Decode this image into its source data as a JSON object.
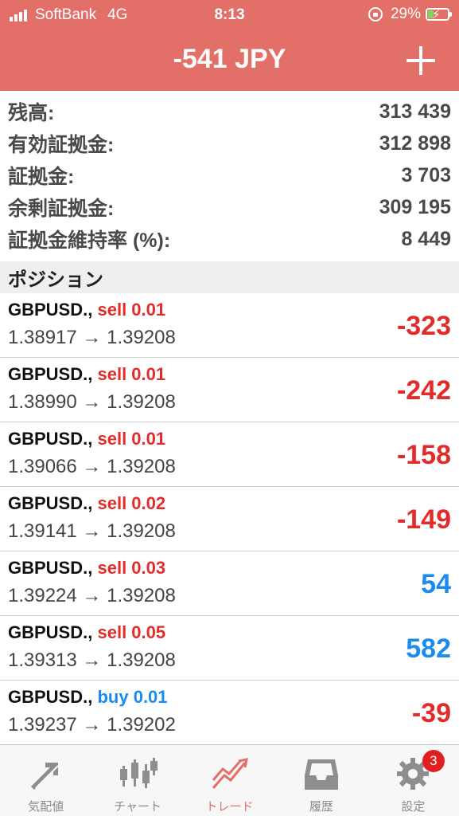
{
  "status_bar": {
    "carrier": "SoftBank",
    "network": "4G",
    "time": "8:13",
    "battery_percent": "29%",
    "battery_level": 0.29
  },
  "header": {
    "title": "-541 JPY",
    "add_icon": "plus-icon"
  },
  "summary": [
    {
      "label": "残高:",
      "value": "313 439"
    },
    {
      "label": "有効証拠金:",
      "value": "312 898"
    },
    {
      "label": "証拠金:",
      "value": "3 703"
    },
    {
      "label": "余剰証拠金:",
      "value": "309 195"
    },
    {
      "label": "証拠金維持率 (%):",
      "value": "8 449"
    }
  ],
  "positions_header": "ポジション",
  "positions": [
    {
      "symbol": "GBPUSD.,",
      "side": "sell 0.01",
      "prices": "1.38917 → 1.39208",
      "profit": "-323",
      "color": "#e22b2b"
    },
    {
      "symbol": "GBPUSD.,",
      "side": "sell 0.01",
      "prices": "1.38990 → 1.39208",
      "profit": "-242",
      "color": "#e22b2b"
    },
    {
      "symbol": "GBPUSD.,",
      "side": "sell 0.01",
      "prices": "1.39066 → 1.39208",
      "profit": "-158",
      "color": "#e22b2b"
    },
    {
      "symbol": "GBPUSD.,",
      "side": "sell 0.02",
      "prices": "1.39141 → 1.39208",
      "profit": "-149",
      "color": "#e22b2b"
    },
    {
      "symbol": "GBPUSD.,",
      "side": "sell 0.03",
      "prices": "1.39224 → 1.39208",
      "profit": "54",
      "color": "#1a8bf0"
    },
    {
      "symbol": "GBPUSD.,",
      "side": "sell 0.05",
      "prices": "1.39313 → 1.39208",
      "profit": "582",
      "color": "#1a8bf0"
    },
    {
      "symbol": "GBPUSD.,",
      "side": "buy 0.01",
      "prices": "1.39237 → 1.39202",
      "profit": "-39",
      "color": "#e22b2b"
    }
  ],
  "tabs": [
    {
      "label": "気配値",
      "icon": "quotes-arrows-icon",
      "active": false
    },
    {
      "label": "チャート",
      "icon": "candlestick-chart-icon",
      "active": false
    },
    {
      "label": "トレード",
      "icon": "trade-trend-icon",
      "active": true
    },
    {
      "label": "履歴",
      "icon": "history-inbox-icon",
      "active": false
    },
    {
      "label": "設定",
      "icon": "gear-icon",
      "active": false,
      "badge": "3"
    }
  ],
  "colors": {
    "accent": "#e36f69",
    "loss": "#e22b2b",
    "profit": "#1a8bf0"
  }
}
